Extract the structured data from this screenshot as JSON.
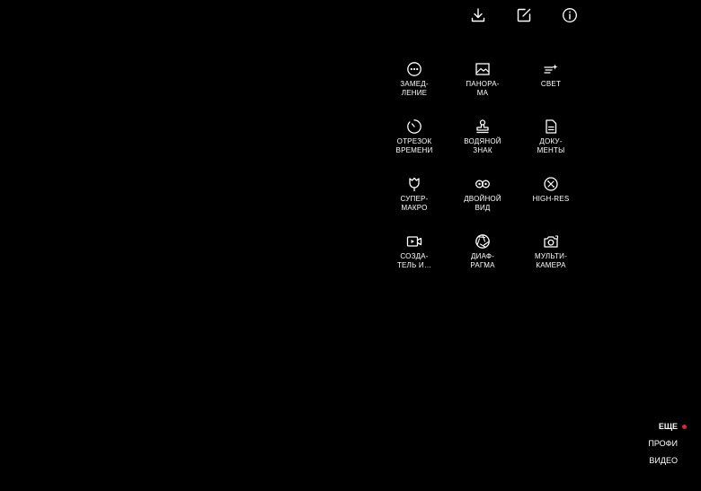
{
  "top_bar": {
    "icons": [
      "download-icon",
      "edit-icon",
      "info-icon"
    ]
  },
  "modes": [
    {
      "label": "ЗАМЕД-\nЛЕНИЕ",
      "icon": "slow-motion-icon"
    },
    {
      "label": "ПАНОРА-\nМА",
      "icon": "panorama-icon"
    },
    {
      "label": "СВЕТ",
      "icon": "light-icon"
    },
    {
      "label": "ОТРЕЗОК\nВРЕМЕНИ",
      "icon": "time-lapse-icon"
    },
    {
      "label": "ВОДЯНОЙ\nЗНАК",
      "icon": "watermark-icon"
    },
    {
      "label": "ДОКУ-\nМЕНТЫ",
      "icon": "document-icon"
    },
    {
      "label": "СУПЕР-\nМАКРО",
      "icon": "macro-flower-icon"
    },
    {
      "label": "ДВОЙНОЙ\nВИД",
      "icon": "dual-view-icon"
    },
    {
      "label": "HIGH-RES",
      "icon": "high-res-icon"
    },
    {
      "label": "СОЗДА-\nТЕЛЬ И…",
      "icon": "video-creator-icon"
    },
    {
      "label": "ДИАФ-\nРАГМА",
      "icon": "aperture-icon"
    },
    {
      "label": "МУЛЬТИ-\nКАМЕРА",
      "icon": "multi-camera-icon"
    }
  ],
  "side_menu": {
    "items": [
      {
        "label": "ЕЩЕ",
        "active": true
      },
      {
        "label": "ПРОФИ",
        "active": false
      },
      {
        "label": "ВИДЕО",
        "active": false
      }
    ],
    "active_dot_color": "#e8202a"
  }
}
